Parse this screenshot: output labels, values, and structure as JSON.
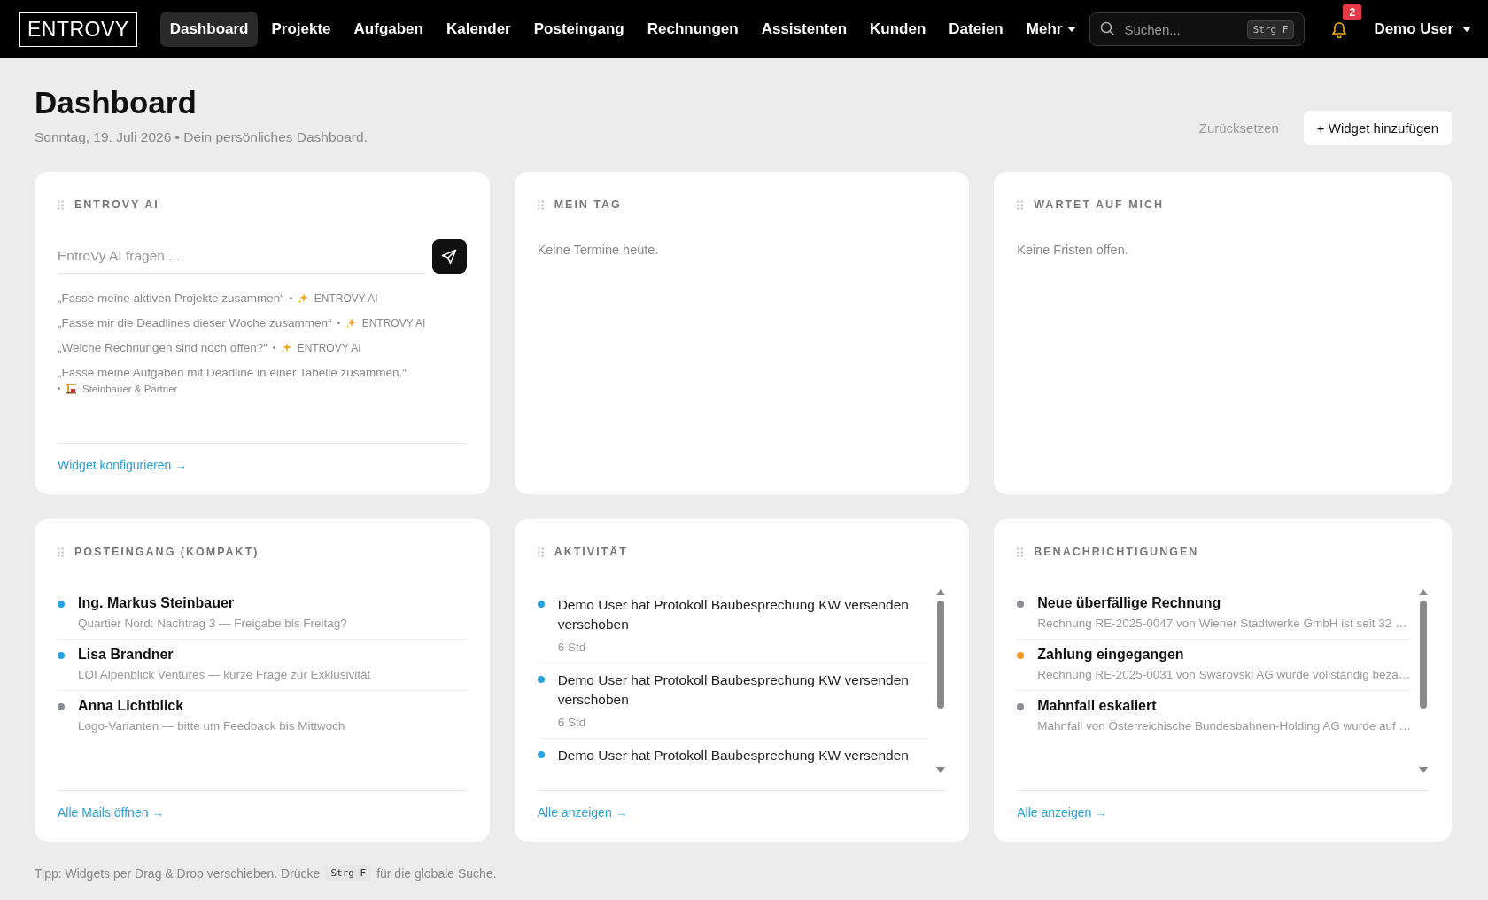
{
  "navbar": {
    "logo": "ENTROVY",
    "items": [
      {
        "label": "Dashboard",
        "selected": true
      },
      {
        "label": "Projekte",
        "selected": false
      },
      {
        "label": "Aufgaben",
        "selected": false
      },
      {
        "label": "Kalender",
        "selected": false
      },
      {
        "label": "Posteingang",
        "selected": false
      },
      {
        "label": "Rechnungen",
        "selected": false
      },
      {
        "label": "Assistenten",
        "selected": false
      },
      {
        "label": "Kunden",
        "selected": false
      },
      {
        "label": "Dateien",
        "selected": false
      }
    ],
    "more": "Mehr",
    "search": {
      "placeholder": "Suchen...",
      "shortcut": "Strg F"
    },
    "notification_count": "2",
    "user": "Demo User"
  },
  "header": {
    "title": "Dashboard",
    "subtitle": "Sonntag, 19. Juli 2026 • Dein persönliches Dashboard.",
    "reset": "Zurücksetzen",
    "add_widget": "+ Widget hinzufügen"
  },
  "widgets": [
    {
      "kind": "ai",
      "title": "ENTROVY AI",
      "placeholder": "EntroVy AI fragen ...",
      "suggestions": [
        {
          "text": "„Fasse meine aktiven Projekte zusammen“",
          "kind": "ai",
          "source": "ENTROVY AI"
        },
        {
          "text": "„Fasse mir die Deadlines dieser Woche zusammen“",
          "kind": "ai",
          "source": "ENTROVY AI"
        },
        {
          "text": "„Welche Rechnungen sind noch offen?“",
          "kind": "ai",
          "source": "ENTROVY AI"
        },
        {
          "text": "„Fasse meine Aufgaben mit Deadline in einer Tabelle zusammen.“",
          "kind": "project",
          "source": "Steinbauer & Partner"
        }
      ],
      "link": "Widget konfigurieren →"
    },
    {
      "kind": "empty",
      "title": "MEIN TAG",
      "message": "Keine Termine heute."
    },
    {
      "kind": "empty",
      "title": "WARTET AUF MICH",
      "message": "Keine Fristen offen."
    },
    {
      "kind": "list",
      "title": "POSTEINGANG (KOMPAKT)",
      "scroll": false,
      "items": [
        {
          "title": "Ing. Markus Steinbauer",
          "text": "Quartier Nord: Nachtrag 3 — Freigabe bis Freitag?",
          "color": "#29a3e0"
        },
        {
          "title": "Lisa Brandner",
          "text": "LOI Alpenblick Ventures — kurze Frage zur Exklusivität",
          "color": "#29a3e0"
        },
        {
          "title": "Anna Lichtblick",
          "text": "Logo-Varianten — bitte um Feedback bis Mittwoch",
          "color": "#8a8d93"
        }
      ],
      "link": "Alle Mails öffnen →"
    },
    {
      "kind": "activity",
      "title": "AKTIVITÄT",
      "scroll": true,
      "items": [
        {
          "text": "Demo User hat Protokoll Baubesprechung KW versenden verschoben",
          "time": "6 Std",
          "color": "#29a3e0"
        },
        {
          "text": "Demo User hat Protokoll Baubesprechung KW versenden verschoben",
          "time": "6 Std",
          "color": "#29a3e0"
        },
        {
          "text": "Demo User hat Protokoll Baubesprechung KW versenden",
          "color": "#29a3e0"
        }
      ],
      "link": "Alle anzeigen →"
    },
    {
      "kind": "list",
      "title": "BENACHRICHTIGUNGEN",
      "scroll": true,
      "items": [
        {
          "title": "Neue überfällige Rechnung",
          "text": "Rechnung RE-2025-0047 von Wiener Stadtwerke GmbH ist seit 32 …",
          "color": "#8a8d93"
        },
        {
          "title": "Zahlung eingegangen",
          "text": "Rechnung RE-2025-0031 von Swarovski AG wurde vollständig beza…",
          "color": "#f29a1f"
        },
        {
          "title": "Mahnfall eskaliert",
          "text": "Mahnfall von Österreichische Bundesbahnen-Holding AG wurde auf …",
          "color": "#8a8d93"
        }
      ],
      "link": "Alle anzeigen →"
    }
  ],
  "footer": {
    "before": "Tipp: Widgets per Drag & Drop verschieben. Drücke",
    "key": "Strg F",
    "after": "für die globale Suche."
  }
}
